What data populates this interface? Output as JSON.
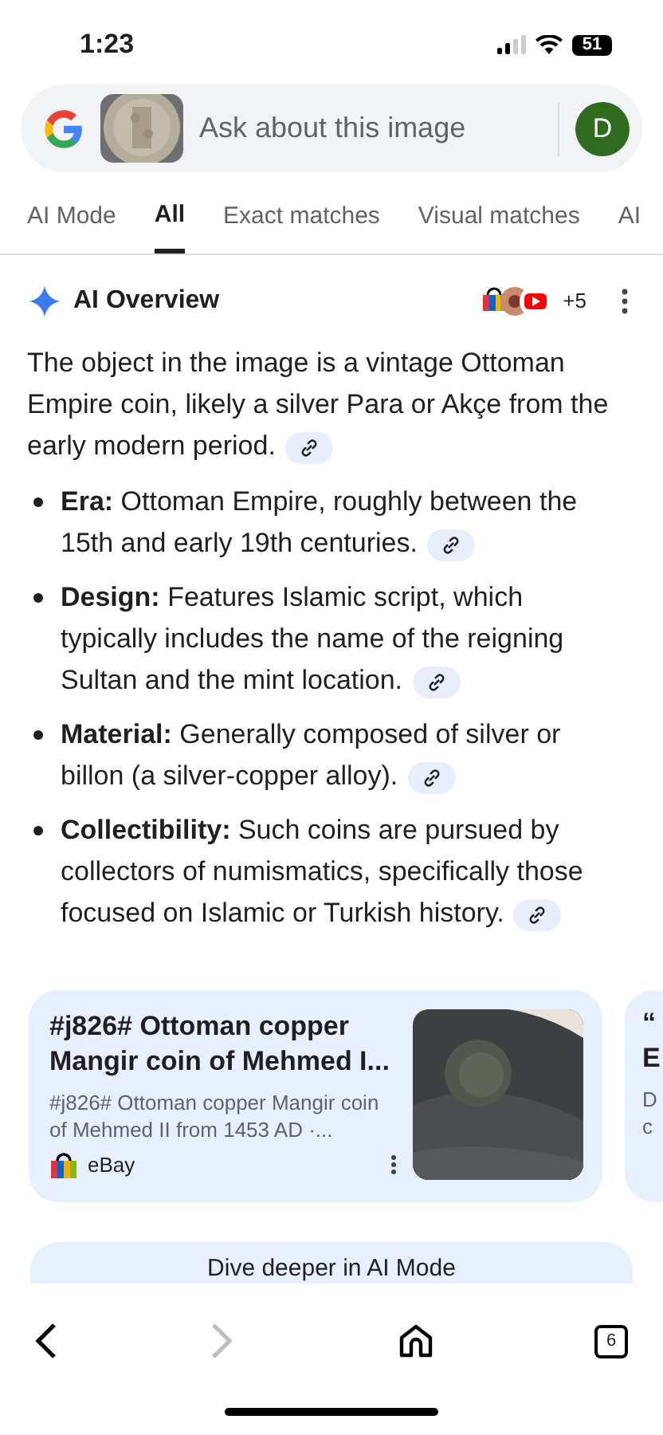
{
  "status_bar": {
    "time": "1:23",
    "battery": "51"
  },
  "search": {
    "placeholder": "Ask about this image",
    "avatar": "D"
  },
  "tabs": [
    {
      "label": "AI Mode",
      "selected": false
    },
    {
      "label": "All",
      "selected": true
    },
    {
      "label": "Exact matches",
      "selected": false
    },
    {
      "label": "Visual matches",
      "selected": false
    },
    {
      "label": "AI",
      "selected": false
    }
  ],
  "overview": {
    "title": "AI Overview",
    "sources_more": "+5",
    "intro": "The object in the image is a vintage Ottoman Empire coin, likely a silver Para or Akçe from the early modern period.",
    "bullets": [
      {
        "text": "**Era:** Ottoman Empire, roughly between the 15th and early 19th centuries."
      },
      {
        "text": "**Design:** Features Islamic script, which typically includes the name of the reigning Sultan and the mint location."
      },
      {
        "text": "**Material:** Generally composed of silver or billon (a silver-copper alloy)."
      },
      {
        "text": "**Collectibility:** Such coins are pursued by collectors of numismatics, specifically those focused on Islamic or Turkish history."
      }
    ]
  },
  "cards": [
    {
      "title": "#j826# Ottoman copper Mangir coin of Mehmed I...",
      "snippet": "#j826# Ottoman copper Mangir coin of Mehmed II from 1453 AD ·...",
      "source": "eBay",
      "kind": "picture"
    }
  ],
  "partial_card": {
    "title_lines": [
      "“",
      "E"
    ],
    "snippet_lines": [
      "D",
      "c"
    ]
  },
  "dive_button": "Dive deeper in AI Mode",
  "bottom_nav": {
    "tab_count": "6",
    "back_disabled": false,
    "forward_disabled": true
  }
}
